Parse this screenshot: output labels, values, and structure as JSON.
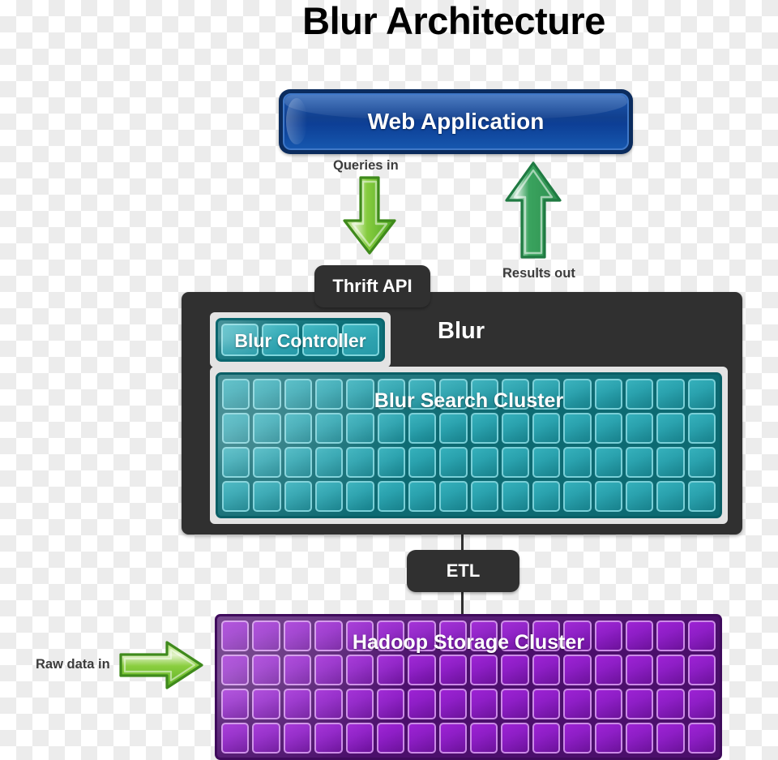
{
  "title": "Blur Architecture",
  "nodes": {
    "web_application": {
      "label": "Web Application",
      "color": "#11408f"
    },
    "thrift_api": {
      "label": "Thrift API",
      "color": "#303030"
    },
    "blur": {
      "label": "Blur",
      "color": "#303030"
    },
    "blur_controller": {
      "label": "Blur Controller",
      "color": "#2ea3b0",
      "columns": 4,
      "rows": 1
    },
    "blur_search_cluster": {
      "label": "Blur Search Cluster",
      "color": "#2aa2ae",
      "columns": 16,
      "rows": 4
    },
    "etl": {
      "label": "ETL",
      "color": "#303030"
    },
    "hadoop_storage_cluster": {
      "label": "Hadoop Storage Cluster",
      "color": "#8e1ec6",
      "columns": 16,
      "rows": 4
    }
  },
  "flows": [
    {
      "id": "queries_in",
      "label": "Queries in",
      "direction": "down",
      "color": "#63c23b"
    },
    {
      "id": "results_out",
      "label": "Results out",
      "direction": "up",
      "color": "#3aa35e"
    },
    {
      "id": "raw_data_in",
      "label": "Raw data in",
      "direction": "right",
      "color": "#7ac93f"
    }
  ]
}
